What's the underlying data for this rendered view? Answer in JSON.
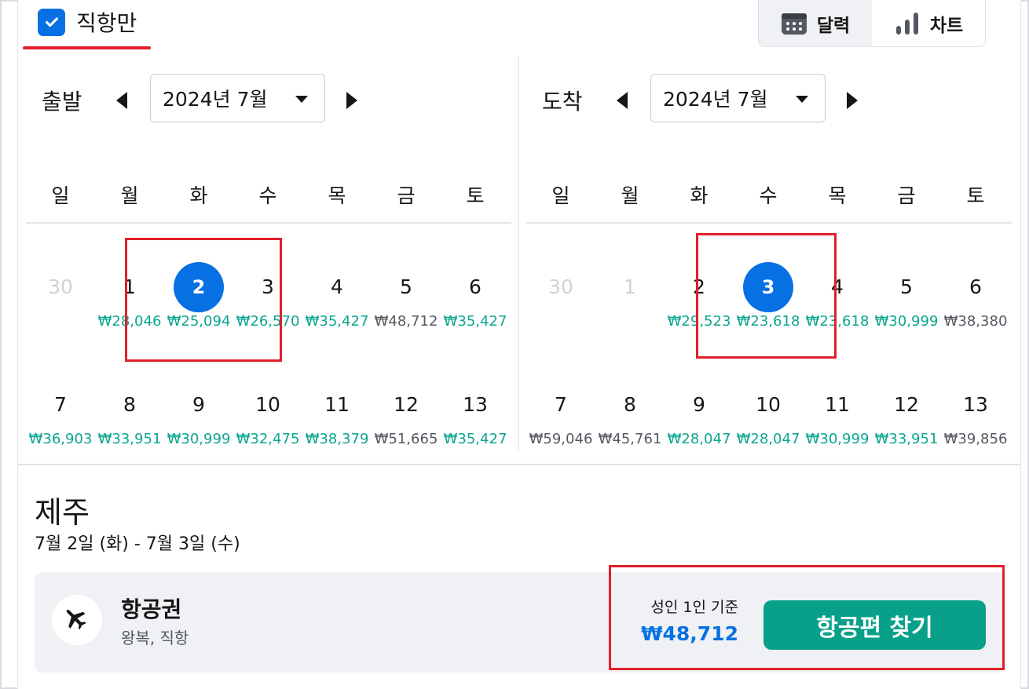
{
  "filter": {
    "direct_only_label": "직항만",
    "direct_only_checked": true
  },
  "view_toggle": {
    "calendar_label": "달력",
    "chart_label": "차트",
    "active": "calendar"
  },
  "weekdays": [
    "일",
    "월",
    "화",
    "수",
    "목",
    "금",
    "토"
  ],
  "departure": {
    "label": "출발",
    "month": "2024년 7월",
    "weeks": [
      [
        {
          "day": "30",
          "price": "",
          "state": "disabled"
        },
        {
          "day": "1",
          "price": "₩28,046",
          "tone": "cheap"
        },
        {
          "day": "2",
          "price": "₩25,094",
          "tone": "cheap",
          "state": "selected"
        },
        {
          "day": "3",
          "price": "₩26,570",
          "tone": "cheap"
        },
        {
          "day": "4",
          "price": "₩35,427",
          "tone": "cheap"
        },
        {
          "day": "5",
          "price": "₩48,712",
          "tone": "normal"
        },
        {
          "day": "6",
          "price": "₩35,427",
          "tone": "cheap"
        }
      ],
      [
        {
          "day": "7",
          "price": "₩36,903",
          "tone": "cheap"
        },
        {
          "day": "8",
          "price": "₩33,951",
          "tone": "cheap"
        },
        {
          "day": "9",
          "price": "₩30,999",
          "tone": "cheap"
        },
        {
          "day": "10",
          "price": "₩32,475",
          "tone": "cheap"
        },
        {
          "day": "11",
          "price": "₩38,379",
          "tone": "cheap"
        },
        {
          "day": "12",
          "price": "₩51,665",
          "tone": "normal"
        },
        {
          "day": "13",
          "price": "₩35,427",
          "tone": "cheap"
        }
      ]
    ]
  },
  "arrival": {
    "label": "도착",
    "month": "2024년 7월",
    "weeks": [
      [
        {
          "day": "30",
          "price": "",
          "state": "disabled"
        },
        {
          "day": "1",
          "price": "",
          "state": "disabled"
        },
        {
          "day": "2",
          "price": "₩29,523",
          "tone": "cheap"
        },
        {
          "day": "3",
          "price": "₩23,618",
          "tone": "cheap",
          "state": "selected"
        },
        {
          "day": "4",
          "price": "₩23,618",
          "tone": "cheap"
        },
        {
          "day": "5",
          "price": "₩30,999",
          "tone": "cheap"
        },
        {
          "day": "6",
          "price": "₩38,380",
          "tone": "normal"
        }
      ],
      [
        {
          "day": "7",
          "price": "₩59,046",
          "tone": "normal"
        },
        {
          "day": "8",
          "price": "₩45,761",
          "tone": "normal"
        },
        {
          "day": "9",
          "price": "₩28,047",
          "tone": "cheap"
        },
        {
          "day": "10",
          "price": "₩28,047",
          "tone": "cheap"
        },
        {
          "day": "11",
          "price": "₩30,999",
          "tone": "cheap"
        },
        {
          "day": "12",
          "price": "₩33,951",
          "tone": "cheap"
        },
        {
          "day": "13",
          "price": "₩39,856",
          "tone": "normal"
        }
      ]
    ]
  },
  "summary": {
    "destination": "제주",
    "date_range": "7월 2일 (화) - 7월 3일 (수)"
  },
  "flight_card": {
    "icon": "airplane-icon",
    "title": "항공권",
    "subtitle": "왕복, 직항",
    "price_basis": "성인 1인 기준",
    "price": "₩48,712",
    "button_label": "항공편 찾기"
  },
  "colors": {
    "accent_blue": "#0770e3",
    "cheap_green": "#0aa58f",
    "button_green": "#08a089",
    "annotation_red": "#e0202a"
  }
}
